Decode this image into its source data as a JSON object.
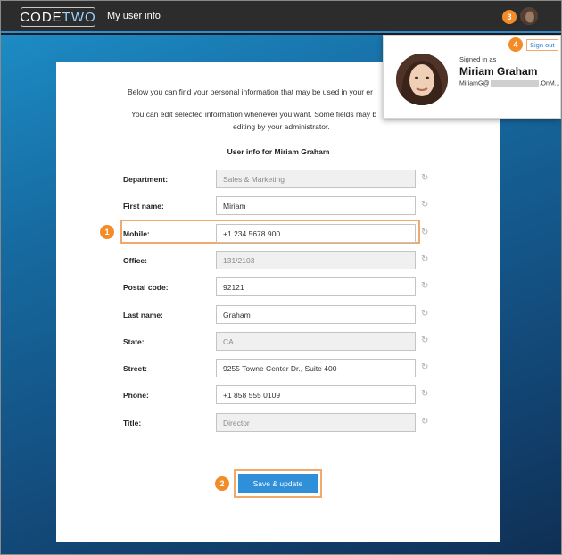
{
  "header": {
    "logo_code": "CODE",
    "logo_two": "TWO",
    "app_title": "My user info"
  },
  "popup": {
    "sign_out": "Sign out",
    "signed_in_as": "Signed in as",
    "name": "Miriam Graham",
    "email_prefix": "MiriamG@",
    "email_suffix": ".OnM..."
  },
  "intro": {
    "line1": "Below you can find your personal information that may be used in your er",
    "line2a": "You can edit selected information whenever you want. Some fields may b",
    "line2b": "editing by your administrator."
  },
  "section_title": "User info for Miriam Graham",
  "fields": [
    {
      "label": "Department:",
      "value": "Sales & Marketing",
      "readonly": true
    },
    {
      "label": "First name:",
      "value": "Miriam",
      "readonly": false
    },
    {
      "label": "Mobile:",
      "value": "+1  234  5678  900",
      "readonly": false
    },
    {
      "label": "Office:",
      "value": "131/2103",
      "readonly": true
    },
    {
      "label": "Postal code:",
      "value": "92121",
      "readonly": false
    },
    {
      "label": "Last name:",
      "value": "Graham",
      "readonly": false
    },
    {
      "label": "State:",
      "value": "CA",
      "readonly": true
    },
    {
      "label": "Street:",
      "value": "9255 Towne Center Dr., Suite 400",
      "readonly": false
    },
    {
      "label": "Phone:",
      "value": "+1 858 555 0109",
      "readonly": false
    },
    {
      "label": "Title:",
      "value": "Director",
      "readonly": true
    }
  ],
  "save_button": "Save & update",
  "badges": [
    "1",
    "2",
    "3",
    "4"
  ],
  "colors": {
    "accent": "#2f8fd8",
    "highlight": "#f0a86b",
    "badge": "#f28c28"
  },
  "icons": {
    "reset": "reset-icon"
  }
}
